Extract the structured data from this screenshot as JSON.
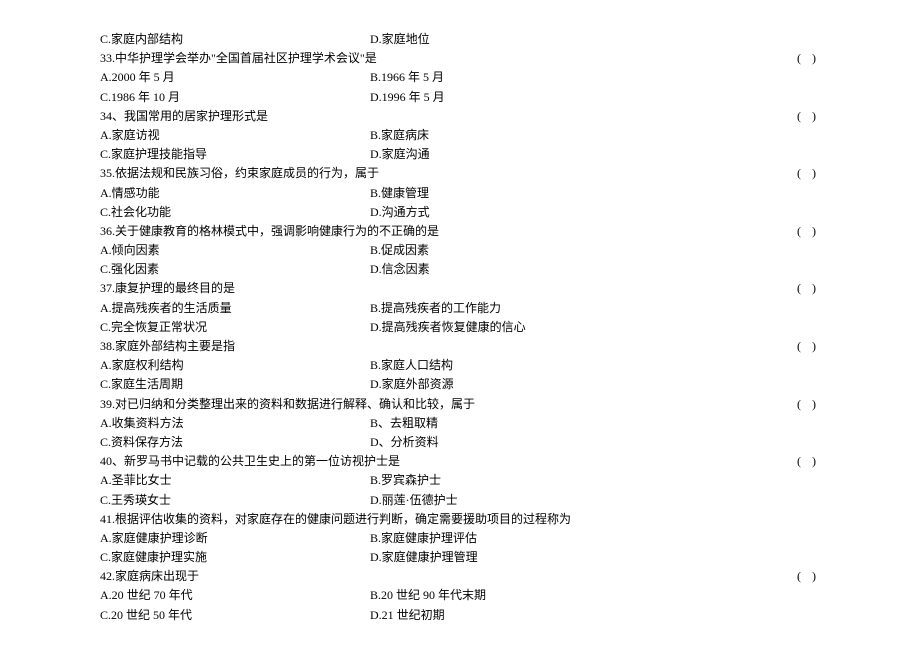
{
  "rows": [
    {
      "left": "C.家庭内部结构",
      "right": "D.家庭地位",
      "blank": ""
    },
    {
      "left": "33.中华护理学会举办\"全国首届社区护理学术会议\"是",
      "right": "",
      "blank": "(    )",
      "full": true
    },
    {
      "left": "A.2000 年 5 月",
      "right": "B.1966 年 5 月",
      "blank": ""
    },
    {
      "left": "C.1986 年 10 月",
      "right": "D.1996 年 5 月",
      "blank": ""
    },
    {
      "left": "34、我国常用的居家护理形式是",
      "right": "",
      "blank": "(    )",
      "full": true
    },
    {
      "left": "A.家庭访视",
      "right": "B.家庭病床",
      "blank": ""
    },
    {
      "left": "C.家庭护理技能指导",
      "right": "D.家庭沟通",
      "blank": ""
    },
    {
      "left": "35.依据法规和民族习俗，约束家庭成员的行为，属于",
      "right": "",
      "blank": "(    )",
      "full": true
    },
    {
      "left": "A.情感功能",
      "right": "B.健康管理",
      "blank": ""
    },
    {
      "left": "C.社会化功能",
      "right": "D.沟通方式",
      "blank": ""
    },
    {
      "left": "36.关于健康教育的格林模式中，强调影响健康行为的不正确的是",
      "right": "",
      "blank": "(    )",
      "full": true
    },
    {
      "left": "A.倾向因素",
      "right": "B.促成因素",
      "blank": ""
    },
    {
      "left": "C.强化因素",
      "right": "D.信念因素",
      "blank": ""
    },
    {
      "left": "37.康复护理的最终目的是",
      "right": "",
      "blank": "(    )",
      "full": true
    },
    {
      "left": "A.提高残疾者的生活质量",
      "right": "B.提高残疾者的工作能力",
      "blank": ""
    },
    {
      "left": "C.完全恢复正常状况",
      "right": "D.提高残疾者恢复健康的信心",
      "blank": ""
    },
    {
      "left": "38.家庭外部结构主要是指",
      "right": "",
      "blank": "(    )",
      "full": true
    },
    {
      "left": "A.家庭权利结构",
      "right": "B.家庭人口结构",
      "blank": ""
    },
    {
      "left": "C.家庭生活周期",
      "right": "D.家庭外部资源",
      "blank": ""
    },
    {
      "left": "39.对已归纳和分类整理出来的资料和数据进行解释、确认和比较，属于",
      "right": "",
      "blank": "(    )",
      "full": true
    },
    {
      "left": "A.收集资料方法",
      "right": "B、去粗取精",
      "blank": ""
    },
    {
      "left": "C.资料保存方法",
      "right": "D、分析资料",
      "blank": ""
    },
    {
      "left": "40、新罗马书中记载的公共卫生史上的第一位访视护士是",
      "right": "",
      "blank": "(    )",
      "full": true
    },
    {
      "left": "A.圣菲比女士",
      "right": "B.罗宾森护士",
      "blank": ""
    },
    {
      "left": "C.王秀瑛女士",
      "right": "D.丽莲·伍德护士",
      "blank": ""
    },
    {
      "left": "41.根据评估收集的资料，对家庭存在的健康问题进行判断，确定需要援助项目的过程称为",
      "right": "",
      "blank": "",
      "full": true
    },
    {
      "left": "A.家庭健康护理诊断",
      "right": "B.家庭健康护理评估",
      "blank": ""
    },
    {
      "left": "C.家庭健康护理实施",
      "right": "D.家庭健康护理管理",
      "blank": ""
    },
    {
      "left": "42.家庭病床出现于",
      "right": "",
      "blank": "(    )",
      "full": true
    },
    {
      "left": "A.20 世纪 70 年代",
      "right": "B.20 世纪 90 年代末期",
      "blank": ""
    },
    {
      "left": "C.20 世纪 50 年代",
      "right": "D.21 世纪初期",
      "blank": ""
    }
  ]
}
